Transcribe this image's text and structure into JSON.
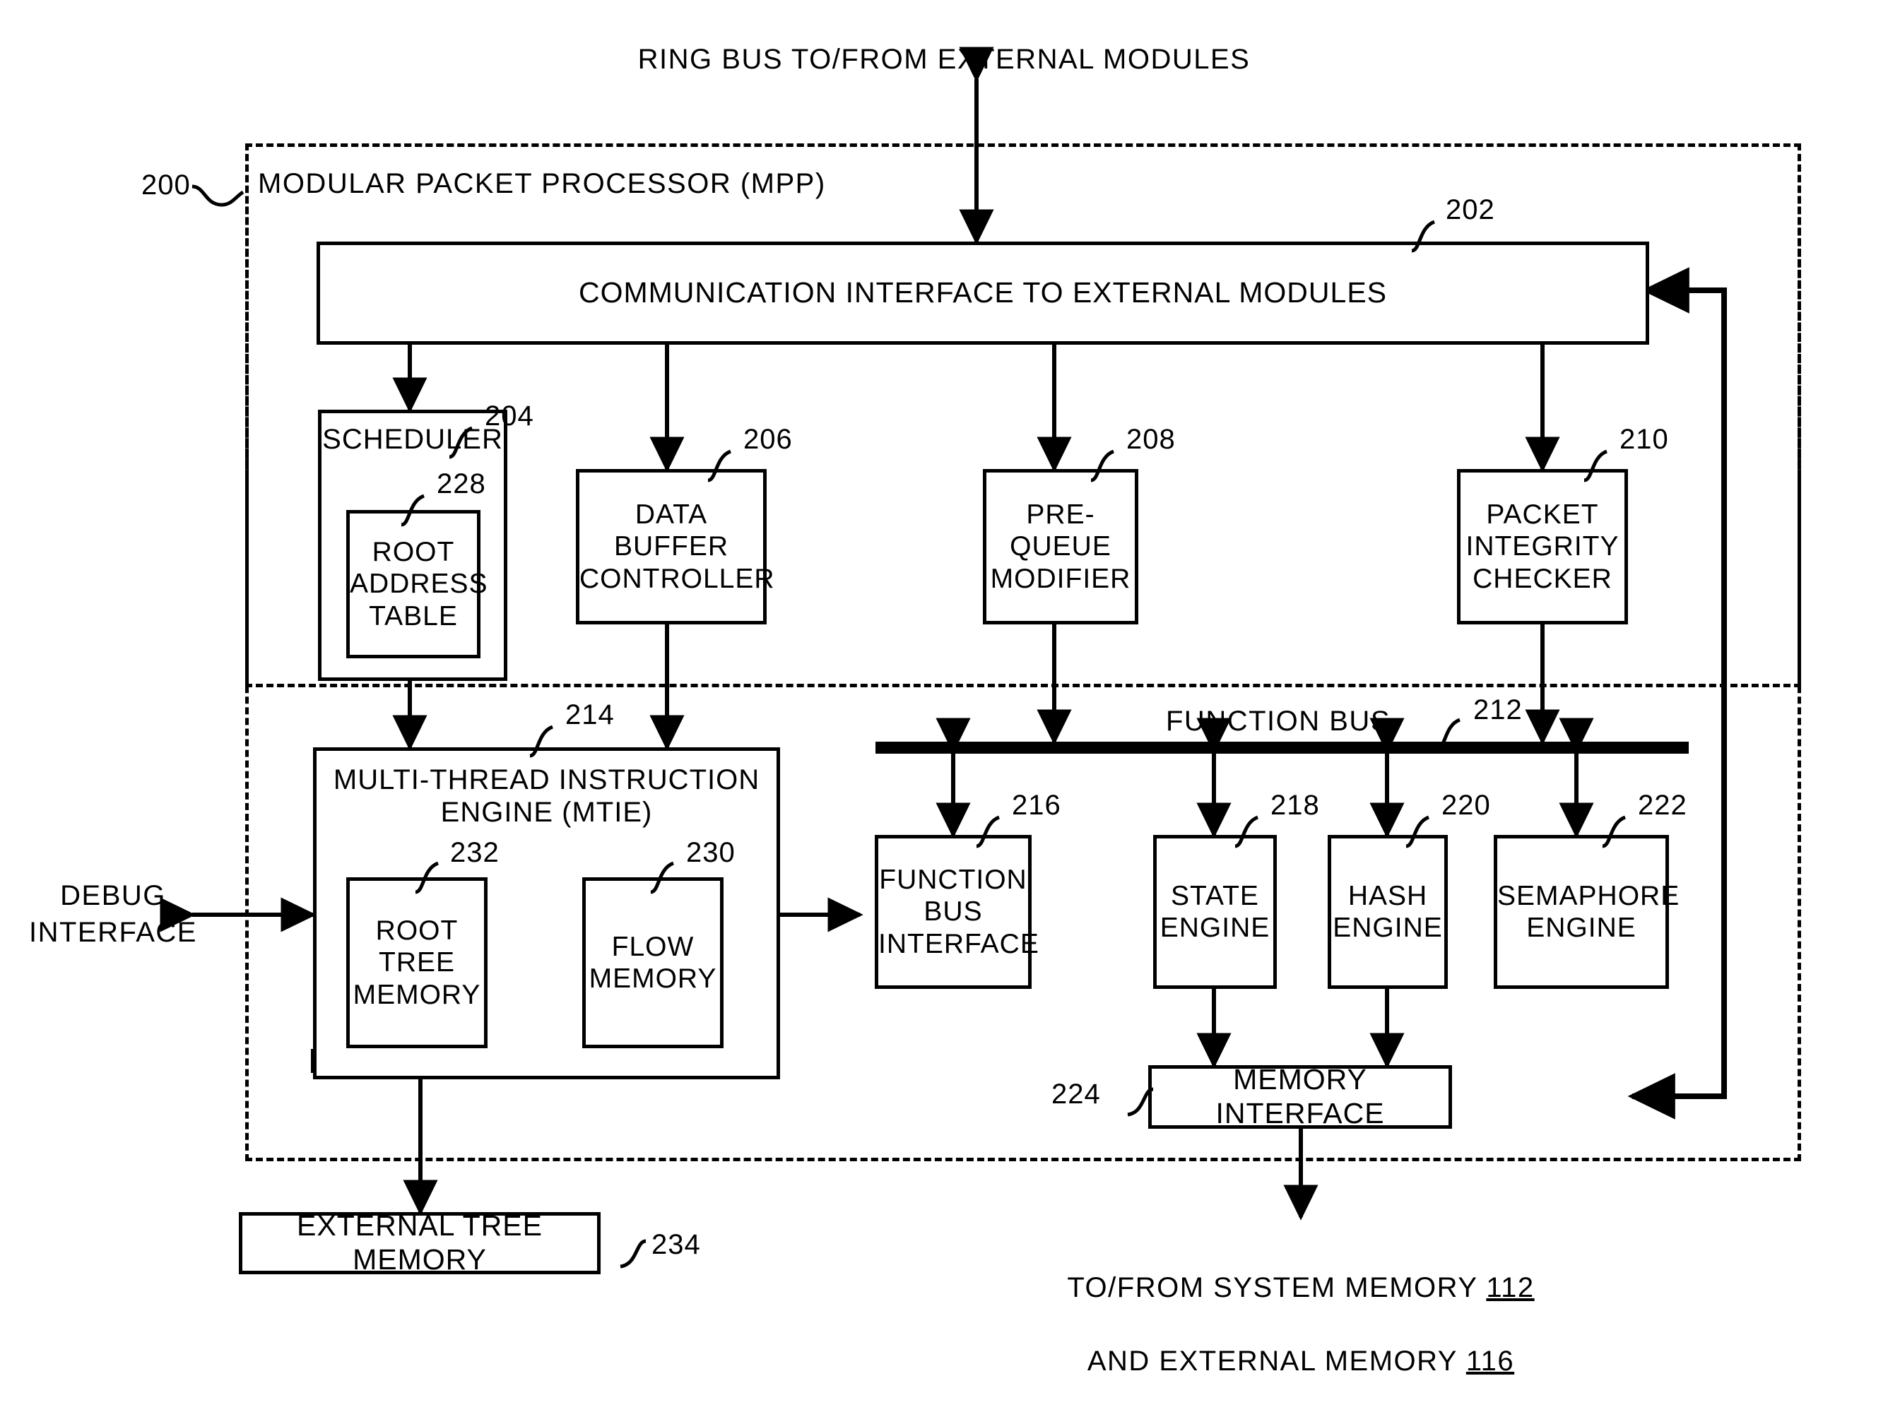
{
  "figure": {
    "top_label": "RING BUS TO/FROM EXTERNAL MODULES",
    "container": {
      "ref": "200",
      "title": "MODULAR PACKET PROCESSOR (MPP)"
    },
    "side_labels": {
      "debug_interface": "DEBUG\nINTERFACE",
      "function_bus": "FUNCTION BUS",
      "memory_note_line1": "TO/FROM SYSTEM MEMORY ",
      "memory_note_num1": "112",
      "memory_note_line2": "AND EXTERNAL MEMORY ",
      "memory_note_num2": "116"
    },
    "blocks": [
      {
        "id": "comm_interface",
        "ref": "202",
        "label": "COMMUNICATION INTERFACE TO EXTERNAL MODULES"
      },
      {
        "id": "scheduler",
        "ref": "204",
        "label": "SCHEDULER"
      },
      {
        "id": "root_address_table",
        "ref": "228",
        "label": "ROOT\nADDRESS\nTABLE"
      },
      {
        "id": "data_buffer_controller",
        "ref": "206",
        "label": "DATA\nBUFFER\nCONTROLLER"
      },
      {
        "id": "pre_queue_modifier",
        "ref": "208",
        "label": "PRE-\nQUEUE\nMODIFIER"
      },
      {
        "id": "packet_integrity_checker",
        "ref": "210",
        "label": "PACKET\nINTEGRITY\nCHECKER"
      },
      {
        "id": "function_bus",
        "ref": "212",
        "label": "FUNCTION BUS"
      },
      {
        "id": "mtie",
        "ref": "214",
        "label": "MULTI-THREAD INSTRUCTION\nENGINE (MTIE)"
      },
      {
        "id": "root_tree_memory",
        "ref": "232",
        "label": "ROOT\nTREE\nMEMORY"
      },
      {
        "id": "flow_memory",
        "ref": "230",
        "label": "FLOW\nMEMORY"
      },
      {
        "id": "function_bus_interface",
        "ref": "216",
        "label": "FUNCTION\nBUS\nINTERFACE"
      },
      {
        "id": "state_engine",
        "ref": "218",
        "label": "STATE\nENGINE"
      },
      {
        "id": "hash_engine",
        "ref": "220",
        "label": "HASH\nENGINE"
      },
      {
        "id": "semaphore_engine",
        "ref": "222",
        "label": "SEMAPHORE\nENGINE"
      },
      {
        "id": "memory_interface",
        "ref": "224",
        "label": "MEMORY INTERFACE"
      },
      {
        "id": "external_tree_memory",
        "ref": "234",
        "label": "EXTERNAL TREE MEMORY"
      }
    ]
  }
}
